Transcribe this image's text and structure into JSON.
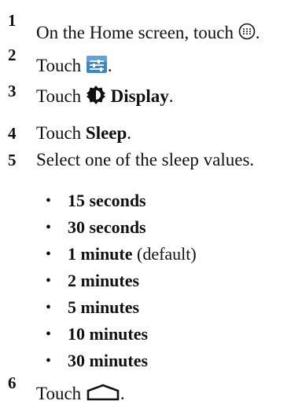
{
  "steps": [
    {
      "number": "1",
      "text_before": "On the Home screen, touch",
      "icon": "all-apps-icon",
      "text_after": "."
    },
    {
      "number": "2",
      "text_before": "Touch",
      "icon": "settings-icon",
      "text_after": "."
    },
    {
      "number": "3",
      "text_before": "Touch",
      "icon": "display-brightness-icon",
      "bold": "Display",
      "text_after": "."
    },
    {
      "number": "4",
      "text_before": "Touch",
      "bold": "Sleep",
      "text_after": "."
    },
    {
      "number": "5",
      "text": "Select one of the sleep values."
    },
    {
      "number": "6",
      "text_before": "Touch",
      "icon": "home-icon",
      "text_after": "."
    }
  ],
  "sleep_values": [
    {
      "value": "15 seconds",
      "note": ""
    },
    {
      "value": "30 seconds",
      "note": ""
    },
    {
      "value": "1 minute",
      "note": "(default)"
    },
    {
      "value": "2 minutes",
      "note": ""
    },
    {
      "value": "5 minutes",
      "note": ""
    },
    {
      "value": "10 minutes",
      "note": ""
    },
    {
      "value": "30 minutes",
      "note": ""
    }
  ],
  "bullet_glyph": "•",
  "colors": {
    "text": "#111111",
    "settings_icon_bg": "#3c86c6"
  }
}
